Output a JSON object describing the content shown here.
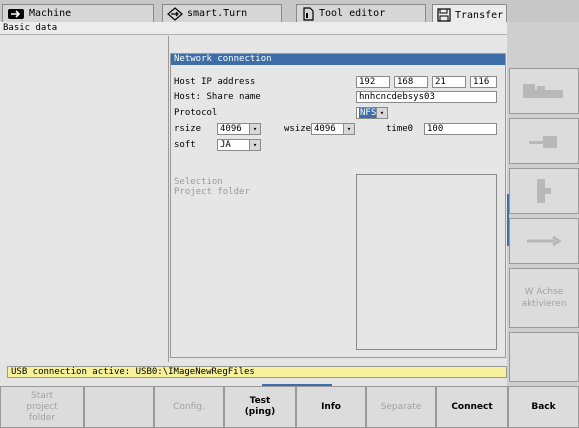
{
  "tabs": [
    {
      "label": "Machine",
      "icon": "arrow-right-icon"
    },
    {
      "label": "smart.Turn",
      "icon": "diamond-arrow-icon"
    },
    {
      "label": "Tool editor",
      "icon": "file-icon"
    },
    {
      "label": "Transfer",
      "icon": "floppy-icon"
    }
  ],
  "breadcrumb": "Basic data",
  "panel": {
    "title": "Network connection",
    "host_ip_label": "Host IP address",
    "ip": [
      "192",
      "168",
      "21",
      "116"
    ],
    "share_label": "Host: Share name",
    "share_value": "hnhcncdebsys03",
    "protocol_label": "Protocol",
    "protocol_value": "NFS",
    "rsize_label": "rsize",
    "rsize_value": "4096",
    "wsize_label": "wsize",
    "wsize_value": "4096",
    "timeo_label": "time0",
    "timeo_value": "100",
    "soft_label": "soft",
    "soft_value": "JA",
    "selection_label": "Selection",
    "project_folder_label": "Project folder"
  },
  "status": "USB connection active: USB0:\\IMageNewRegFiles",
  "softkeys": [
    {
      "label": "Start\nproject\nfolder",
      "enabled": false
    },
    {
      "label": "",
      "enabled": false
    },
    {
      "label": "Config.",
      "enabled": false
    },
    {
      "label": "Test\n(ping)",
      "enabled": true
    },
    {
      "label": "Info",
      "enabled": true
    },
    {
      "label": "Separate",
      "enabled": false
    },
    {
      "label": "Connect",
      "enabled": true
    },
    {
      "label": "Back",
      "enabled": true
    }
  ],
  "vertical_softkeys": [
    {
      "icon": "machine-tool-icon",
      "label": ""
    },
    {
      "icon": "tailstock-icon",
      "label": ""
    },
    {
      "icon": "chuck-icon",
      "label": ""
    },
    {
      "icon": "wrench-icon",
      "label": ""
    },
    {
      "icon": "",
      "label": "W Achse aktivieren"
    },
    {
      "icon": "",
      "label": ""
    }
  ]
}
